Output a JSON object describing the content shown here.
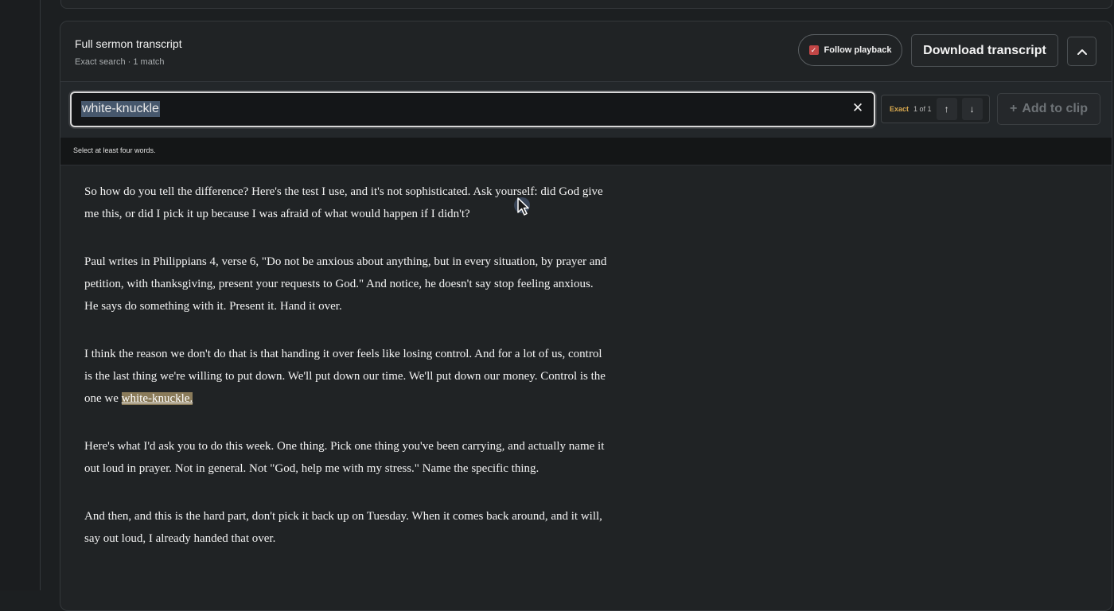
{
  "panel": {
    "title": "Full sermon transcript",
    "subtitle": "Exact search · 1 match"
  },
  "toolbar": {
    "follow_label": "Follow playback",
    "follow_checked": true,
    "download_label": "Download transcript",
    "collapse_icon": "chevron-up-icon"
  },
  "search": {
    "value": "white-knuckle",
    "mode_label": "Exact",
    "count": "1 of 1",
    "prev_symbol": "↑",
    "next_symbol": "↓",
    "clear_symbol": "✕",
    "add_symbol": "+",
    "add_label": "Add to clip"
  },
  "hint": "Select at least four words.",
  "transcript": {
    "p1": "So how do you tell the difference? Here's the test I use, and it's not sophisticated. Ask yourself: did God give me this, or did I pick it up because I was afraid of what would happen if I didn't?",
    "p2": "Paul writes in Philippians 4, verse 6, \"Do not be anxious about anything, but in every situation, by prayer and petition, with thanksgiving, present your requests to God.\" And notice, he doesn't say stop feeling anxious. He says do something with it. Present it. Hand it over.",
    "p3_before": "I think the reason we don't do that is that handing it over feels like losing control. And for a lot of us, control is the last thing we're willing to put down. We'll put down our time. We'll put down our money. Control is the one we ",
    "p3_match": "white-knuckle.",
    "p4": "Here's what I'd ask you to do this week. One thing. Pick one thing you've been carrying, and actually name it out loud in prayer. Not in general. Not \"God, help me with my stress.\" Name the specific thing.",
    "p5": "And then, and this is the hard part, don't pick it back up on Tuesday. When it comes back around, and it will, say out loud, I already handed that over."
  },
  "colors": {
    "background": "#1c1f21",
    "highlight": "#8a7b5a",
    "exact_badge": "#d9a94f",
    "checkbox": "#c24646"
  }
}
